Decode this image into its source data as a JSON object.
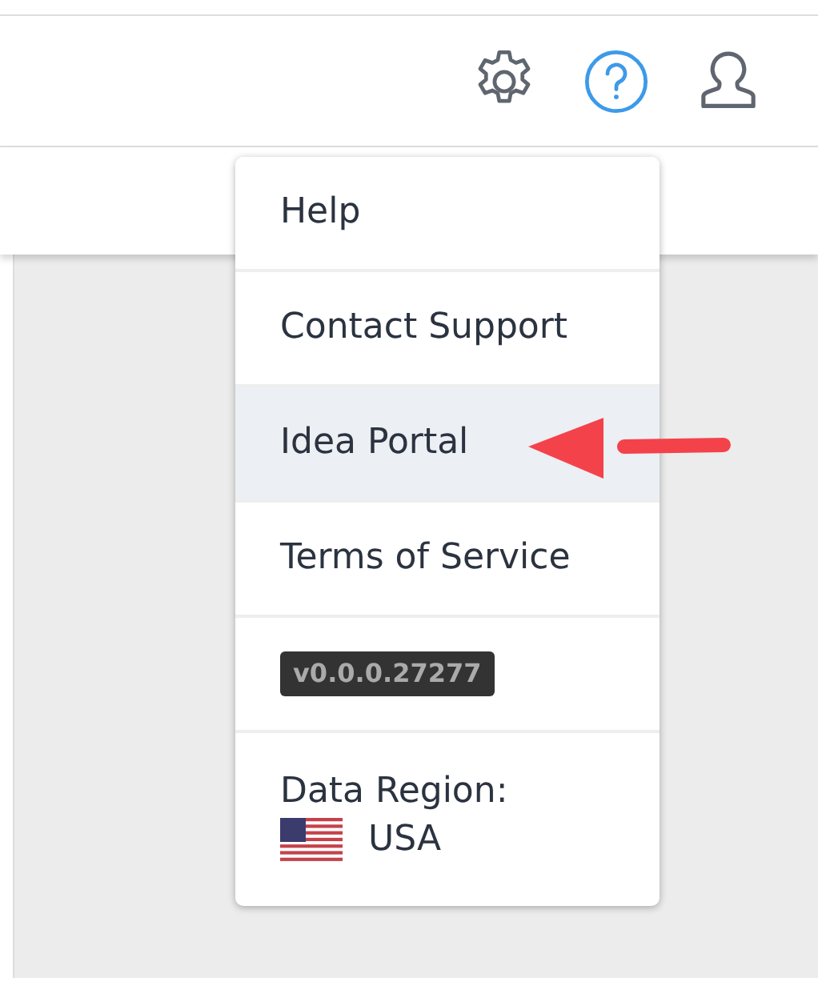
{
  "toolbar": {
    "icons": [
      {
        "kind": "gear",
        "active": false
      },
      {
        "kind": "help",
        "active": true
      },
      {
        "kind": "user",
        "active": false
      }
    ]
  },
  "help_menu": {
    "items": [
      {
        "label": "Help",
        "highlighted": false
      },
      {
        "label": "Contact Support",
        "highlighted": false
      },
      {
        "label": "Idea Portal",
        "highlighted": true
      },
      {
        "label": "Terms of Service",
        "highlighted": false
      }
    ],
    "version": "v0.0.0.27277",
    "data_region": {
      "label": "Data Region:",
      "value": "USA"
    }
  }
}
